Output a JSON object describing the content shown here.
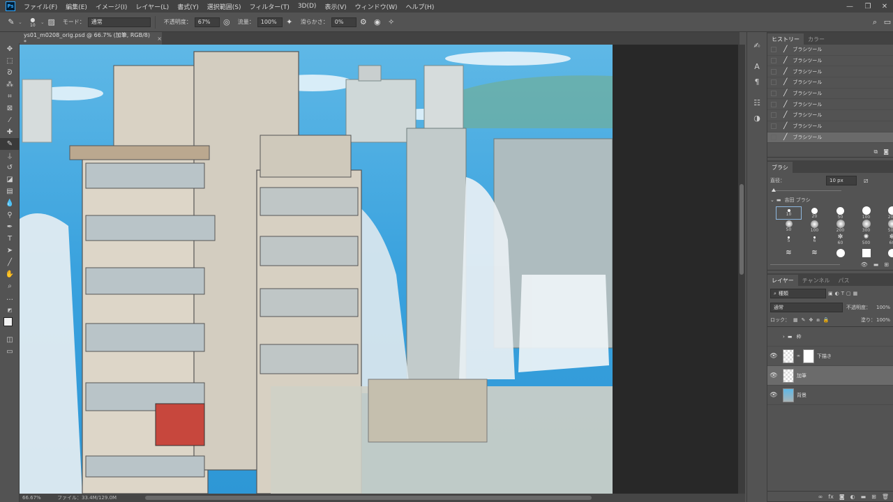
{
  "menubar": {
    "items": [
      "ファイル(F)",
      "編集(E)",
      "イメージ(I)",
      "レイヤー(L)",
      "書式(Y)",
      "選択範囲(S)",
      "フィルター(T)",
      "3D(D)",
      "表示(V)",
      "ウィンドウ(W)",
      "ヘルプ(H)"
    ],
    "logo": "Ps"
  },
  "options": {
    "brush_size": "10",
    "mode_label": "モード：",
    "mode_value": "通常",
    "opacity_label": "不透明度：",
    "opacity_value": "67%",
    "flow_label": "流量：",
    "flow_value": "100%",
    "smoothing_label": "滑らかさ：",
    "smoothing_value": "0%"
  },
  "document": {
    "tab_title": "ys01_m0208_orig.psd @ 66.7% (加筆, RGB/8) *",
    "close": "×"
  },
  "status": {
    "zoom": "66.67%",
    "file_info": "ファイル：33.4M/129.0M"
  },
  "history_panel": {
    "tabs": [
      "ヒストリー",
      "カラー"
    ],
    "items": [
      "ブラシツール",
      "ブラシツール",
      "ブラシツール",
      "ブラシツール",
      "ブラシツール",
      "ブラシツール",
      "ブラシツール",
      "ブラシツール",
      "ブラシツール"
    ]
  },
  "brush_panel": {
    "tab": "ブラシ",
    "diameter_label": "直径：",
    "diameter_value": "10 px",
    "group_name": "吉田 ブラシ",
    "presets": [
      "10",
      "20",
      "50",
      "100",
      "200",
      "50",
      "100",
      "200",
      "300",
      "500",
      "5",
      "6",
      "60",
      "500",
      "60",
      "",
      "",
      "",
      "",
      ""
    ]
  },
  "layers_panel": {
    "tabs": [
      "レイヤー",
      "チャンネル",
      "パス"
    ],
    "filter_label": "種類",
    "blend_mode": "通常",
    "opacity_label": "不透明度：",
    "opacity_value": "100%",
    "lock_label": "ロック：",
    "fill_label": "塗り：",
    "fill_value": "100%",
    "layers": [
      {
        "name": "枠",
        "type": "group"
      },
      {
        "name": "下描き",
        "type": "layer"
      },
      {
        "name": "加筆",
        "type": "layer",
        "selected": true
      },
      {
        "name": "背景",
        "type": "layer"
      }
    ]
  },
  "colors": {
    "accent": "#31a8ff",
    "app_bg": "#535353",
    "menubar": "#424242",
    "canvas_bg": "#282828"
  }
}
